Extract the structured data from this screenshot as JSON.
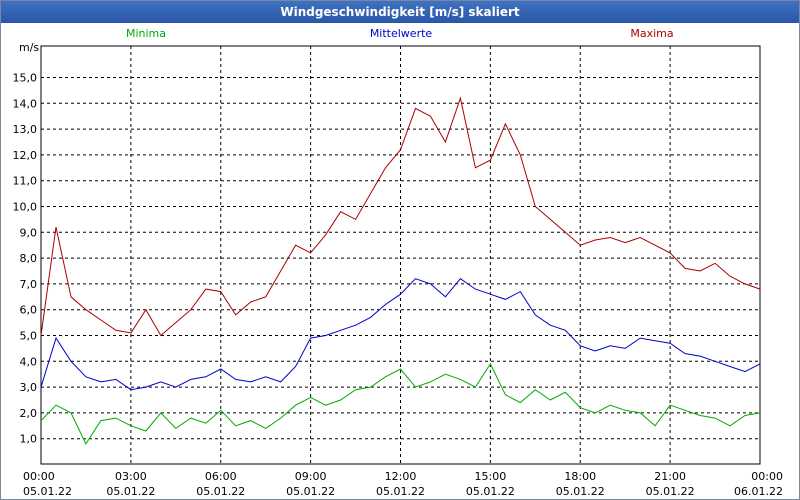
{
  "chart_data": {
    "type": "line",
    "title": "Windgeschwindigkeit [m/s] skaliert",
    "ylabel": "m/s",
    "xlabel": "",
    "ylim": [
      0,
      16
    ],
    "y_ticks": [
      "1,0",
      "2,0",
      "3,0",
      "4,0",
      "5,0",
      "6,0",
      "7,0",
      "8,0",
      "9,0",
      "10,0",
      "11,0",
      "12,0",
      "13,0",
      "14,0",
      "15,0"
    ],
    "x_ticks": [
      {
        "time": "00:00",
        "date": "05.01.22"
      },
      {
        "time": "03:00",
        "date": "05.01.22"
      },
      {
        "time": "06:00",
        "date": "05.01.22"
      },
      {
        "time": "09:00",
        "date": "05.01.22"
      },
      {
        "time": "12:00",
        "date": "05.01.22"
      },
      {
        "time": "15:00",
        "date": "05.01.22"
      },
      {
        "time": "18:00",
        "date": "05.01.22"
      },
      {
        "time": "21:00",
        "date": "05.01.22"
      },
      {
        "time": "00:00",
        "date": "06.01.22"
      }
    ],
    "x_unit": "hours since 05.01.22 00:00",
    "xlim": [
      0,
      24
    ],
    "grid": true,
    "legend_position": "top",
    "series": [
      {
        "name": "Minima",
        "color": "#00aa00",
        "x": [
          0,
          0.5,
          1,
          1.5,
          2,
          2.5,
          3,
          3.5,
          4,
          4.5,
          5,
          5.5,
          6,
          6.5,
          7,
          7.5,
          8,
          8.5,
          9,
          9.5,
          10,
          10.5,
          11,
          11.5,
          12,
          12.5,
          13,
          13.5,
          14,
          14.5,
          15,
          15.5,
          16,
          16.5,
          17,
          17.5,
          18,
          18.5,
          19,
          19.5,
          20,
          20.5,
          21,
          21.5,
          22,
          22.5,
          23,
          23.5,
          24
        ],
        "values": [
          1.7,
          2.3,
          2.0,
          0.8,
          1.7,
          1.8,
          1.5,
          1.3,
          2.0,
          1.4,
          1.8,
          1.6,
          2.1,
          1.5,
          1.7,
          1.4,
          1.8,
          2.3,
          2.6,
          2.3,
          2.5,
          2.9,
          3.0,
          3.4,
          3.7,
          3.0,
          3.2,
          3.5,
          3.3,
          3.0,
          3.9,
          2.7,
          2.4,
          2.9,
          2.5,
          2.8,
          2.2,
          2.0,
          2.3,
          2.1,
          2.0,
          1.5,
          2.3,
          2.1,
          1.9,
          1.8,
          1.5,
          1.9,
          2.0
        ]
      },
      {
        "name": "Mittelwerte",
        "color": "#0000cc",
        "x": [
          0,
          0.5,
          1,
          1.5,
          2,
          2.5,
          3,
          3.5,
          4,
          4.5,
          5,
          5.5,
          6,
          6.5,
          7,
          7.5,
          8,
          8.5,
          9,
          9.5,
          10,
          10.5,
          11,
          11.5,
          12,
          12.5,
          13,
          13.5,
          14,
          14.5,
          15,
          15.5,
          16,
          16.5,
          17,
          17.5,
          18,
          18.5,
          19,
          19.5,
          20,
          20.5,
          21,
          21.5,
          22,
          22.5,
          23,
          23.5,
          24
        ],
        "values": [
          3.0,
          4.9,
          4.0,
          3.4,
          3.2,
          3.3,
          2.9,
          3.0,
          3.2,
          3.0,
          3.3,
          3.4,
          3.7,
          3.3,
          3.2,
          3.4,
          3.2,
          3.8,
          4.9,
          5.0,
          5.2,
          5.4,
          5.7,
          6.2,
          6.6,
          7.2,
          7.0,
          6.5,
          7.2,
          6.8,
          6.6,
          6.4,
          6.7,
          5.8,
          5.4,
          5.2,
          4.6,
          4.4,
          4.6,
          4.5,
          4.9,
          4.8,
          4.7,
          4.3,
          4.2,
          4.0,
          3.8,
          3.6,
          3.9
        ]
      },
      {
        "name": "Maxima",
        "color": "#aa0000",
        "x": [
          0,
          0.5,
          1,
          1.5,
          2,
          2.5,
          3,
          3.5,
          4,
          4.5,
          5,
          5.5,
          6,
          6.5,
          7,
          7.5,
          8,
          8.5,
          9,
          9.5,
          10,
          10.5,
          11,
          11.5,
          12,
          12.5,
          13,
          13.5,
          14,
          14.5,
          15,
          15.5,
          16,
          16.5,
          17,
          17.5,
          18,
          18.5,
          19,
          19.5,
          20,
          20.5,
          21,
          21.5,
          22,
          22.5,
          23,
          23.5,
          24
        ],
        "values": [
          5.0,
          9.2,
          6.5,
          6.0,
          5.6,
          5.2,
          5.1,
          6.0,
          5.0,
          5.5,
          6.0,
          6.8,
          6.7,
          5.8,
          6.3,
          6.5,
          7.5,
          8.5,
          8.2,
          8.9,
          9.8,
          9.5,
          10.5,
          11.5,
          12.2,
          13.8,
          13.5,
          12.5,
          14.2,
          11.5,
          11.8,
          13.2,
          12.0,
          10.0,
          9.5,
          9.0,
          8.5,
          8.7,
          8.8,
          8.6,
          8.8,
          8.5,
          8.2,
          7.6,
          7.5,
          7.8,
          7.3,
          7.0,
          6.8
        ]
      }
    ]
  }
}
